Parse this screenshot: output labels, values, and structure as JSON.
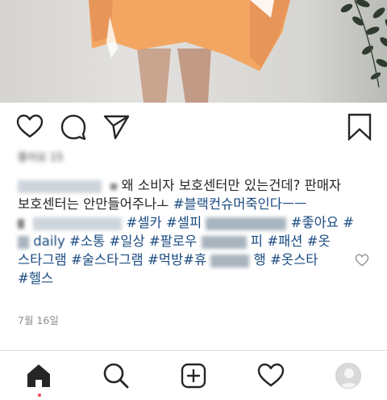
{
  "post": {
    "likes_label": "좋아요 15",
    "caption": {
      "line1_text": "왜 소비자 보호센터만 있는건데? 판매자",
      "line2_text": "보호센터는 안만들어주나ㅗ",
      "line2_tag": "#블랙컨슈머죽인다ㅡㅡ",
      "line3_tags": [
        "#셀카",
        "#셀피",
        "#좋아요",
        "#"
      ],
      "line4_text": "daily",
      "line4_tags": [
        "#소통",
        "#일상",
        "#팔로우",
        "#패션",
        "#옷"
      ],
      "line4_partial": "피",
      "line5_tags": [
        "스타그램",
        "#술스타그램",
        "#먹방",
        "#휴",
        "#옷스타"
      ],
      "line5_partial": "행",
      "line6_tags": [
        "#헬스"
      ]
    },
    "date": "7월 16일"
  },
  "actions": {
    "like": "heart-outline-icon",
    "comment": "comment-bubble-icon",
    "share": "paper-plane-icon",
    "save": "bookmark-icon"
  },
  "nav": {
    "items": [
      "home-icon",
      "search-icon",
      "new-post-icon",
      "activity-heart-icon",
      "profile-avatar"
    ]
  },
  "colors": {
    "hashtag": "#1b4b82",
    "text": "#262626",
    "muted": "#8e8e8e",
    "divider": "#dbdbdb",
    "sweater": "#f2a662"
  }
}
